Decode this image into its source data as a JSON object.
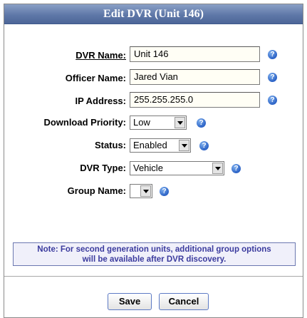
{
  "dialog": {
    "title": "Edit DVR (Unit 146)"
  },
  "form": {
    "dvr_name": {
      "label": "DVR Name:",
      "value": "Unit 146"
    },
    "officer_name": {
      "label": "Officer Name:",
      "value": "Jared Vian"
    },
    "ip_address": {
      "label": "IP Address:",
      "value": "255.255.255.0"
    },
    "download_priority": {
      "label": "Download Priority:",
      "value": "Low"
    },
    "status": {
      "label": "Status:",
      "value": "Enabled"
    },
    "dvr_type": {
      "label": "DVR Type:",
      "value": "Vehicle"
    },
    "group_name": {
      "label": "Group Name:",
      "value": ""
    },
    "help_glyph": "?"
  },
  "note": {
    "line1": "Note: For second generation units, additional group options",
    "line2": "will be available after DVR discovery."
  },
  "buttons": {
    "save": "Save",
    "cancel": "Cancel"
  },
  "colors": {
    "title_bar": "#5f78a8",
    "note_text": "#3b3b9e",
    "help_icon": "#2c63c6"
  },
  "icons": {
    "help": "help-icon",
    "dropdown": "chevron-down-icon"
  }
}
